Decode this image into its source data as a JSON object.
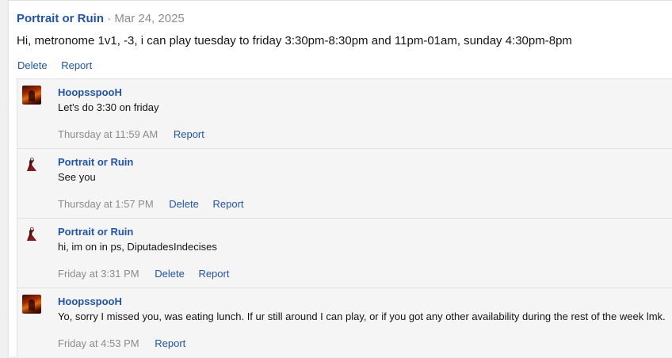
{
  "post": {
    "author": "Portrait or Ruin",
    "separator": "·",
    "date": "Mar 24, 2025",
    "body": "Hi, metronome 1v1, -3, i can play tuesday to friday 3:30pm-8:30pm and 11pm-01am, sunday 4:30pm-8pm",
    "actions": {
      "delete": "Delete",
      "report": "Report"
    }
  },
  "comments": [
    {
      "author": "HoopsspooH",
      "avatar": "flame-avatar",
      "text": "Let's do 3:30 on friday",
      "time": "Thursday at 11:59 AM",
      "delete": "",
      "report": "Report"
    },
    {
      "author": "Portrait or Ruin",
      "avatar": "figure-avatar",
      "text": "See you",
      "time": "Thursday at 1:57 PM",
      "delete": "Delete",
      "report": "Report"
    },
    {
      "author": "Portrait or Ruin",
      "avatar": "figure-avatar",
      "text": "hi, im on in ps, DiputadesIndecises",
      "time": "Friday at 3:31 PM",
      "delete": "Delete",
      "report": "Report"
    },
    {
      "author": "HoopsspooH",
      "avatar": "flame-avatar",
      "text": "Yo, sorry I missed you, was eating lunch. If ur still around I can play, or if you got any other availability during the rest of the week lmk.",
      "time": "Friday at 4:53 PM",
      "delete": "",
      "report": "Report"
    }
  ],
  "colors": {
    "link": "#1f54b3",
    "muted": "#8c8c8c",
    "text": "#141414",
    "comment_bg": "#f5f5f5"
  }
}
